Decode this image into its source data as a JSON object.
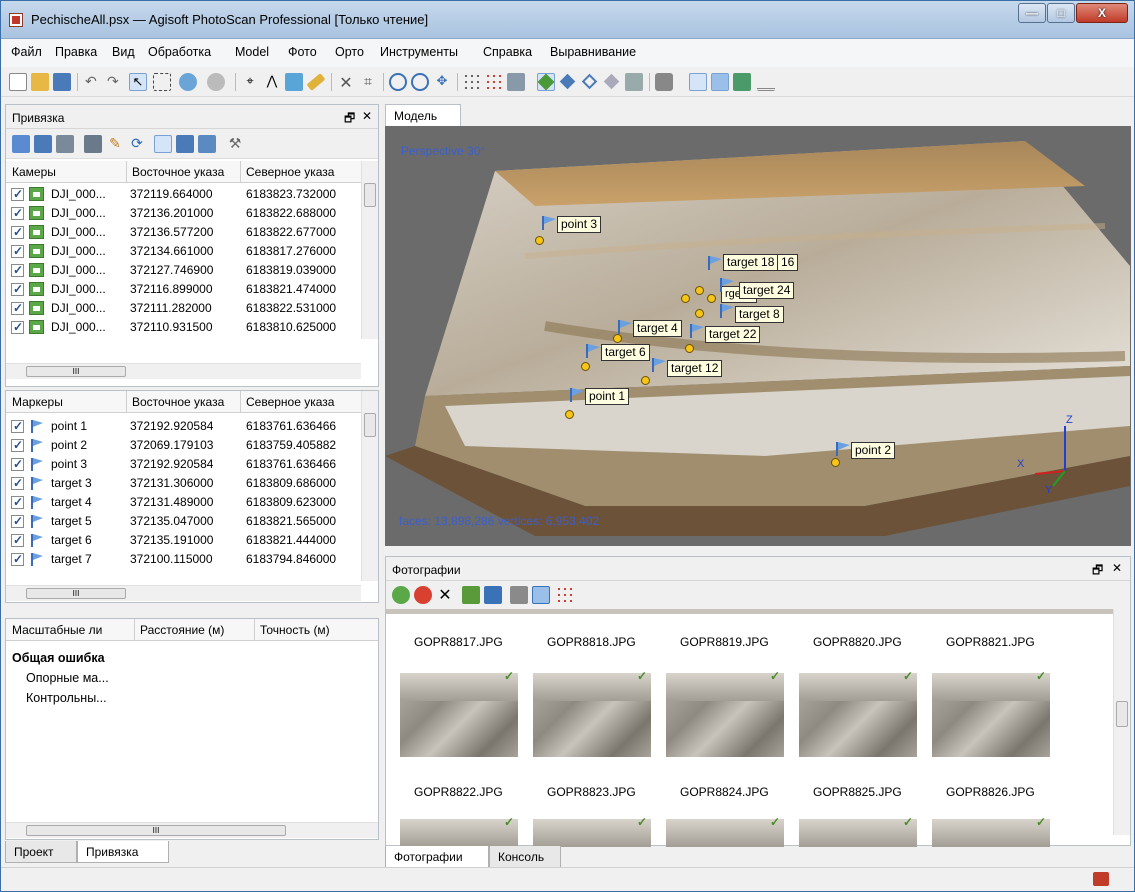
{
  "window": {
    "title": "PechischeAll.psx — Agisoft PhotoScan Professional [Только чтение]",
    "min_label": "—",
    "max_label": "□",
    "close_label": "X"
  },
  "menu": [
    "Файл",
    "Правка",
    "Вид",
    "Обработка",
    "Model",
    "Фото",
    "Орто",
    "Инструменты",
    "Справка",
    "Выравнивание"
  ],
  "reference_panel": {
    "title": "Привязка",
    "cameras_header": [
      "Камеры",
      "Восточное указа",
      "Северное указа"
    ],
    "cameras": [
      {
        "name": "DJI_000...",
        "east": "372119.664000",
        "north": "6183823.732000"
      },
      {
        "name": "DJI_000...",
        "east": "372136.201000",
        "north": "6183822.688000"
      },
      {
        "name": "DJI_000...",
        "east": "372136.577200",
        "north": "6183822.677000"
      },
      {
        "name": "DJI_000...",
        "east": "372134.661000",
        "north": "6183817.276000"
      },
      {
        "name": "DJI_000...",
        "east": "372127.746900",
        "north": "6183819.039000"
      },
      {
        "name": "DJI_000...",
        "east": "372116.899000",
        "north": "6183821.474000"
      },
      {
        "name": "DJI_000...",
        "east": "372111.282000",
        "north": "6183822.531000"
      },
      {
        "name": "DJI_000...",
        "east": "372110.931500",
        "north": "6183810.625000"
      }
    ],
    "markers_header": [
      "Маркеры",
      "Восточное указа",
      "Северное указа"
    ],
    "markers": [
      {
        "name": "point 1",
        "east": "372192.920584",
        "north": "6183761.636466"
      },
      {
        "name": "point 2",
        "east": "372069.179103",
        "north": "6183759.405882"
      },
      {
        "name": "point 3",
        "east": "372192.920584",
        "north": "6183761.636466"
      },
      {
        "name": "target 3",
        "east": "372131.306000",
        "north": "6183809.686000"
      },
      {
        "name": "target 4",
        "east": "372131.489000",
        "north": "6183809.623000"
      },
      {
        "name": "target 5",
        "east": "372135.047000",
        "north": "6183821.565000"
      },
      {
        "name": "target 6",
        "east": "372135.191000",
        "north": "6183821.444000"
      },
      {
        "name": "target 7",
        "east": "372100.115000",
        "north": "6183794.846000"
      }
    ],
    "scale_header": [
      "Масштабные ли",
      "Расстояние (м)",
      "Точность (м)"
    ],
    "scale_items": {
      "total": "Общая ошибка",
      "control": "Опорные ма...",
      "check": "Контрольны..."
    },
    "scroll_glyph": "III"
  },
  "left_tabs": [
    "Проект",
    "Привязка"
  ],
  "model": {
    "tab": "Модель",
    "projection": "Perspective 30°",
    "stats": "faces: 13,898,286 vertices: 6,953,402",
    "axes": {
      "x": "X",
      "y": "Y",
      "z": "Z"
    },
    "markers": [
      "point 3",
      "target 18",
      "16",
      "target 24",
      "target 8",
      "target 4",
      "target 22",
      "target 6",
      "target 12",
      "point 1",
      "point 2",
      "rget 1"
    ]
  },
  "photos": {
    "title": "Фотографии",
    "row1": [
      "GOPR8817.JPG",
      "GOPR8818.JPG",
      "GOPR8819.JPG",
      "GOPR8820.JPG",
      "GOPR8821.JPG"
    ],
    "row2": [
      "GOPR8822.JPG",
      "GOPR8823.JPG",
      "GOPR8824.JPG",
      "GOPR8825.JPG",
      "GOPR8826.JPG"
    ],
    "badge": "✓"
  },
  "right_tabs": [
    "Фотографии",
    "Консоль"
  ],
  "panel_controls": {
    "float": "🗗",
    "close": "✕"
  },
  "colors": {
    "accent": "#2a5d8e",
    "marker_label_bg": "#fffde0",
    "model_bg": "#6b6b6b",
    "projection_text": "#3a5fcf"
  }
}
